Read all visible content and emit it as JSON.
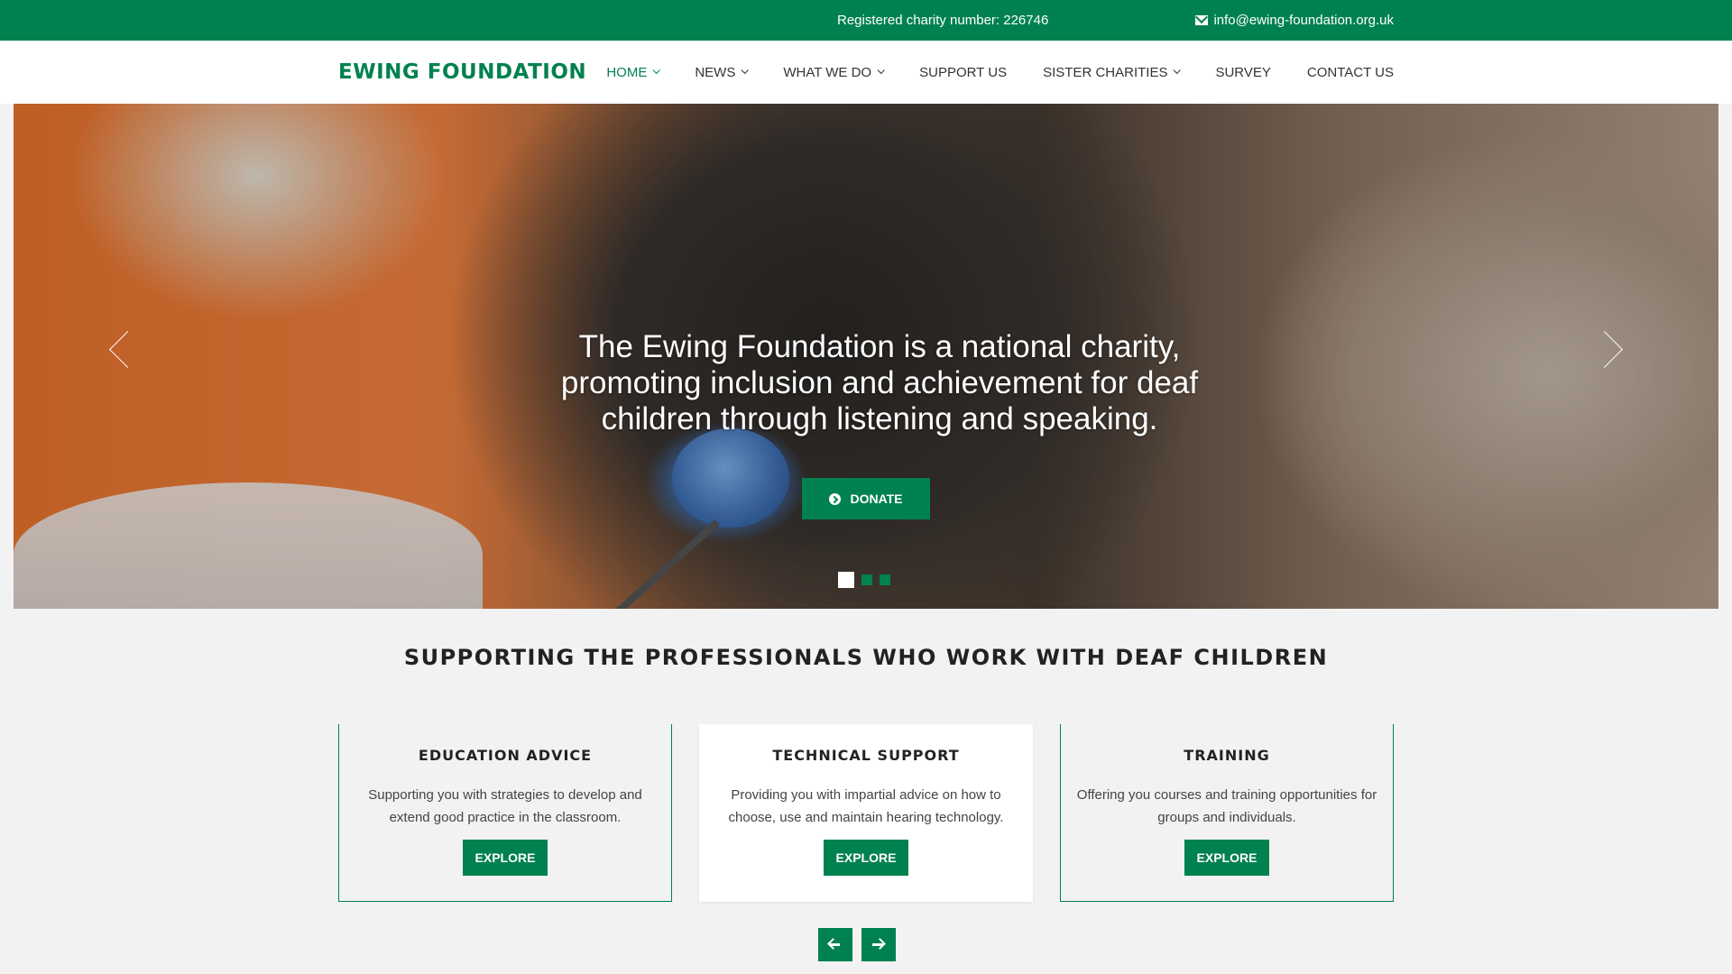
{
  "topbar": {
    "charity_number": "Registered charity number: 226746",
    "email": "info@ewing-foundation.org.uk",
    "email_icon": "envelope-icon"
  },
  "brand": {
    "name": "EWING FOUNDATION",
    "color": "#008150"
  },
  "nav": {
    "items": [
      {
        "label": "HOME",
        "dropdown": true,
        "active": true
      },
      {
        "label": "NEWS",
        "dropdown": true
      },
      {
        "label": "WHAT WE DO",
        "dropdown": true
      },
      {
        "label": "SUPPORT US",
        "dropdown": false
      },
      {
        "label": "SISTER CHARITIES",
        "dropdown": true
      },
      {
        "label": "SURVEY",
        "dropdown": false
      },
      {
        "label": "CONTACT US",
        "dropdown": false
      }
    ]
  },
  "hero": {
    "line1": "The Ewing Foundation is a national charity,",
    "line2": "promoting inclusion and achievement for deaf",
    "line3": "children through listening and speaking.",
    "donate_label": "DONATE",
    "slides": {
      "count": 3,
      "active": 1
    }
  },
  "section": {
    "title": "SUPPORTING THE PROFESSIONALS WHO WORK WITH DEAF CHILDREN"
  },
  "cards": [
    {
      "title": "EDUCATION ADVICE",
      "text": "Supporting you with strategies to develop and extend good practice in the classroom.",
      "button": "EXPLORE"
    },
    {
      "title": "TECHNICAL SUPPORT",
      "text": "Providing you with impartial advice on how to choose, use and maintain hearing technology.",
      "button": "EXPLORE"
    },
    {
      "title": "TRAINING",
      "text": "Offering you courses and training opportunities for groups and individuals.",
      "button": "EXPLORE"
    }
  ]
}
